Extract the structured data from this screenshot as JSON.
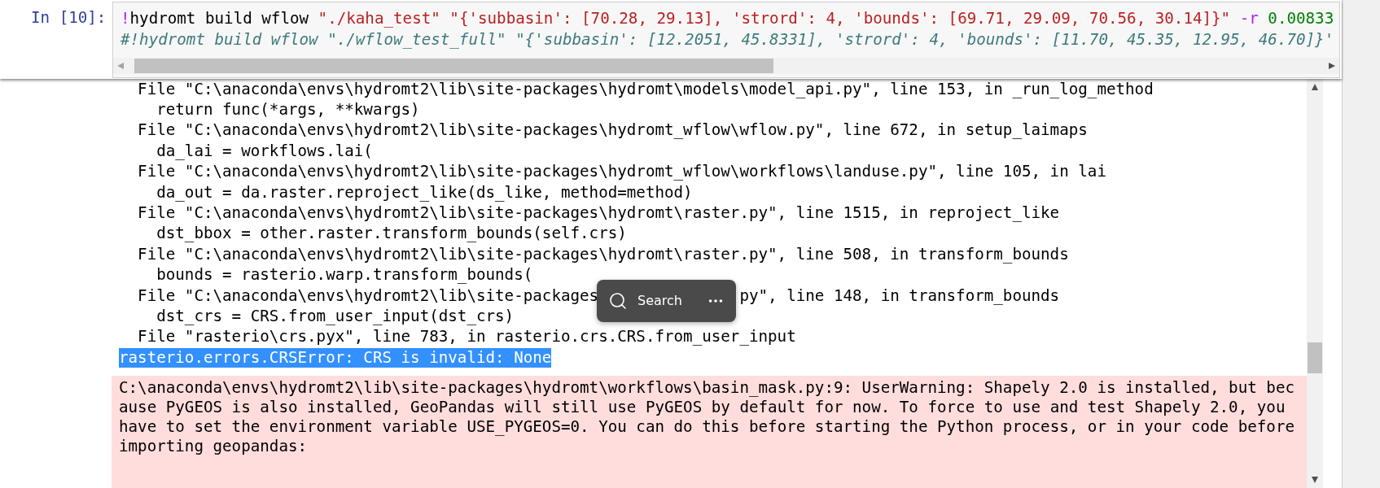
{
  "cell": {
    "prompt": "In [10]:",
    "input_lines": [
      [
        {
          "kind": "operator",
          "text": "!"
        },
        {
          "kind": "plain",
          "text": "hydromt build wflow "
        },
        {
          "kind": "string",
          "text": "\"./kaha_test\" "
        },
        {
          "kind": "string",
          "text": "\"{'subbasin': [70.28, 29.13], 'strord': 4, 'bounds': [69.71, 29.09, 70.56, 30.14]}\" "
        },
        {
          "kind": "operator",
          "text": "-r"
        },
        {
          "kind": "number",
          "text": " 0.00833"
        }
      ],
      [
        {
          "kind": "comment",
          "text": "#!hydromt build wflow \"./wflow_test_full\" \"{'subbasin': [12.2051, 45.8331], 'strord': 4, 'bounds': [11.70, 45.35, 12.95, 46.70]}'"
        }
      ]
    ]
  },
  "output": {
    "traceback_lines": [
      {
        "kind": "frame",
        "selected": false,
        "segments": [
          "File \"C:\\anaconda\\envs\\hydromt2\\lib\\site-packages\\hydromt\\models\\model_api.py\", line 153, in _run_log_method"
        ]
      },
      {
        "kind": "code",
        "selected": false,
        "segments": [
          "return func(*args, **kwargs)"
        ]
      },
      {
        "kind": "frame",
        "selected": false,
        "segments": [
          "File \"C:\\anaconda\\envs\\hydromt2\\lib\\site-packages\\hydromt_wflow\\wflow.py\", line 672, in setup_laimaps"
        ]
      },
      {
        "kind": "code",
        "selected": false,
        "segments": [
          "da_lai = workflows.lai("
        ]
      },
      {
        "kind": "frame",
        "selected": false,
        "segments": [
          "File \"C:\\anaconda\\envs\\hydromt2\\lib\\site-packages\\hydromt_wflow\\workflows\\landuse.py\", line 105, in lai"
        ]
      },
      {
        "kind": "code",
        "selected": false,
        "segments": [
          "da_out = da.raster.reproject_like(ds_like, method=method)"
        ]
      },
      {
        "kind": "frame",
        "selected": false,
        "segments": [
          "File \"C:\\anaconda\\envs\\hydromt2\\lib\\site-packages\\hydromt\\raster.py\", line 1515, in reproject_like"
        ]
      },
      {
        "kind": "code",
        "selected": false,
        "segments": [
          "dst_bbox = other.raster.transform_bounds(self.crs)"
        ]
      },
      {
        "kind": "frame",
        "selected": false,
        "segments": [
          "File \"C:\\anaconda\\envs\\hydromt2\\lib\\site-packages\\hydromt\\raster.py\", line 508, in transform_bounds"
        ]
      },
      {
        "kind": "code",
        "selected": false,
        "segments": [
          "bounds = rasterio.warp.transform_bounds("
        ]
      },
      {
        "kind": "frame",
        "selected": false,
        "popup": {
          "label": "Search"
        },
        "segments": [
          "File \"C:\\anaconda\\envs\\hydromt2\\lib\\site-packages",
          "py\", line 148, in transform_bounds"
        ]
      },
      {
        "kind": "code",
        "selected": false,
        "segments": [
          "dst_crs = CRS.from_user_input(dst_crs)"
        ]
      },
      {
        "kind": "frame",
        "selected": false,
        "segments": [
          "File \"rasterio\\crs.pyx\", line 783, in rasterio.crs.CRS.from_user_input"
        ]
      },
      {
        "kind": "error",
        "selected": true,
        "segments": [
          "rasterio.errors.CRSError: CRS is invalid: None"
        ]
      }
    ],
    "stderr": {
      "text": "C:\\anaconda\\envs\\hydromt2\\lib\\site-packages\\hydromt\\workflows\\basin_mask.py:9: UserWarning: Shapely 2.0 is installed, but because PyGEOS is also installed, GeoPandas will still use PyGEOS by default for now. To force to use and test Shapely 2.0, you have to set the environment variable USE_PYGEOS=0. You can do this before starting the Python process, or in your code before importing geopandas:"
    }
  }
}
